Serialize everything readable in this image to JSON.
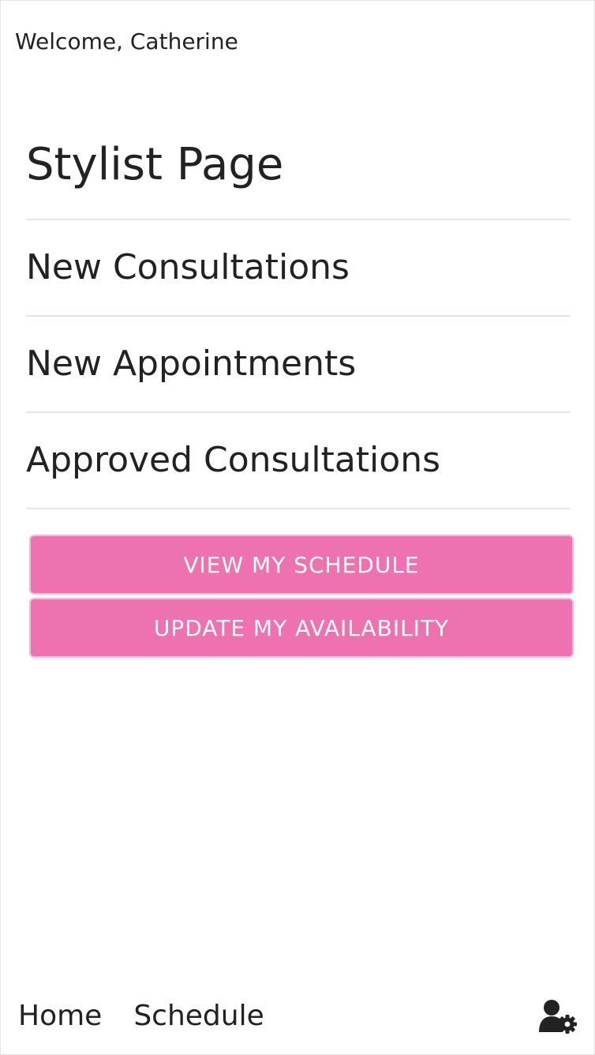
{
  "header": {
    "welcome_text": "Welcome, Catherine"
  },
  "main": {
    "title": "Stylist Page",
    "sections": [
      {
        "label": "New Consultations"
      },
      {
        "label": "New Appointments"
      },
      {
        "label": "Approved Consultations"
      }
    ],
    "buttons": {
      "view_schedule": "VIEW MY SCHEDULE",
      "update_availability": "UPDATE MY AVAILABILITY"
    }
  },
  "bottom_nav": {
    "home": "Home",
    "schedule": "Schedule",
    "settings_icon": "user-gear-icon"
  },
  "colors": {
    "accent_pink": "#ee72b0",
    "text_dark": "#222222",
    "divider": "#e6e6e6"
  }
}
